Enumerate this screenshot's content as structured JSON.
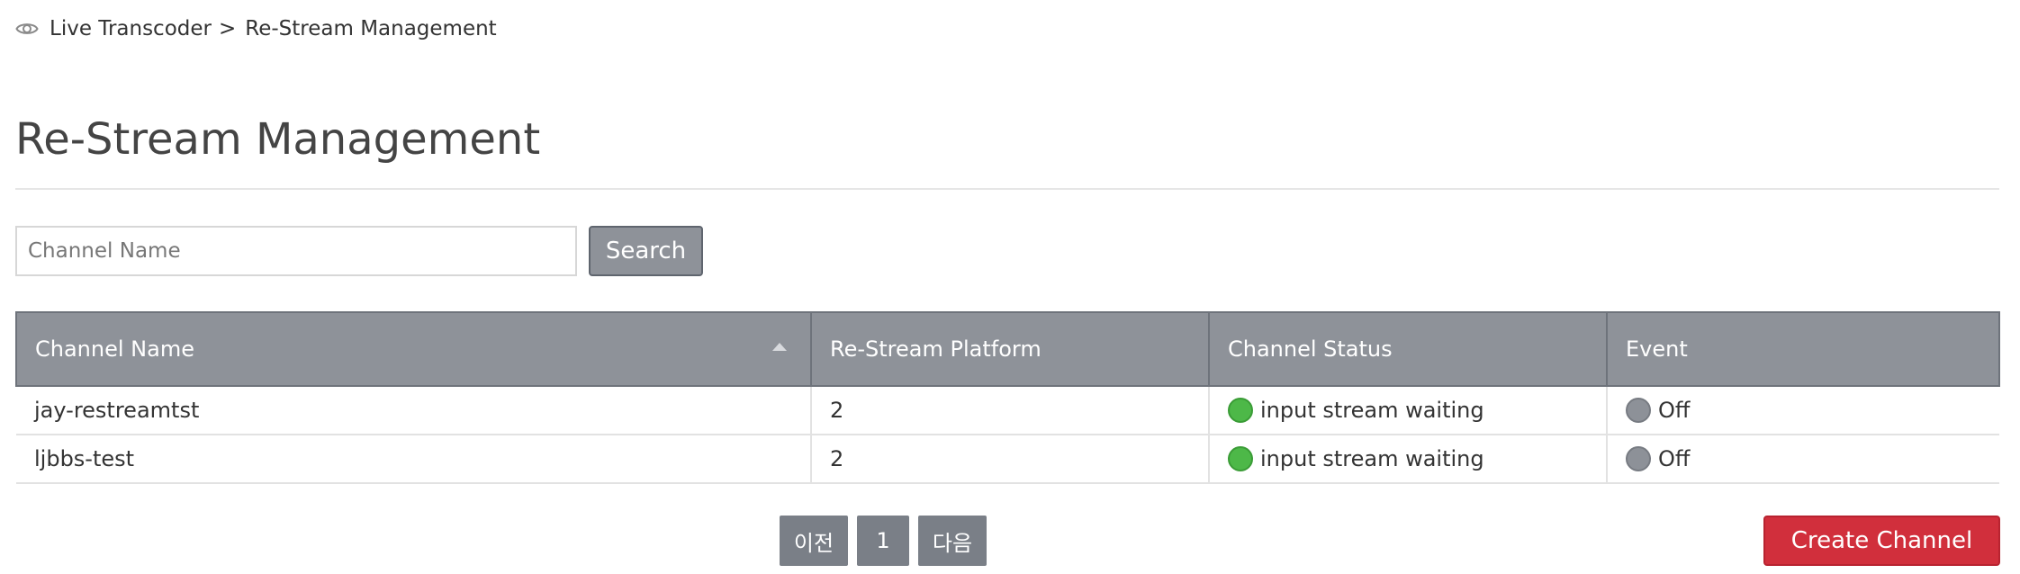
{
  "breadcrumb": {
    "icon": "eye-icon",
    "items": [
      "Live Transcoder",
      "Re-Stream Management"
    ],
    "separator": ">"
  },
  "page": {
    "title": "Re-Stream Management"
  },
  "search": {
    "placeholder": "Channel Name",
    "value": "",
    "button_label": "Search"
  },
  "table": {
    "columns": [
      "Channel Name",
      "Re-Stream Platform",
      "Channel Status",
      "Event"
    ],
    "sort": {
      "column": "Channel Name",
      "direction": "ascending",
      "icon": "sort-up-icon"
    },
    "rows": [
      {
        "channel_name": "jay-restreamtst",
        "platform": "2",
        "status": "input stream waiting",
        "status_color": "#4db848",
        "event": "Off",
        "event_color": "#8d9198"
      },
      {
        "channel_name": "ljbbs-test",
        "platform": "2",
        "status": "input stream waiting",
        "status_color": "#4db848",
        "event": "Off",
        "event_color": "#8d9198"
      }
    ]
  },
  "pagination": {
    "prev_label": "이전",
    "current_page": "1",
    "next_label": "다음"
  },
  "actions": {
    "create_label": "Create Channel",
    "create_color": "#d12f3c"
  }
}
